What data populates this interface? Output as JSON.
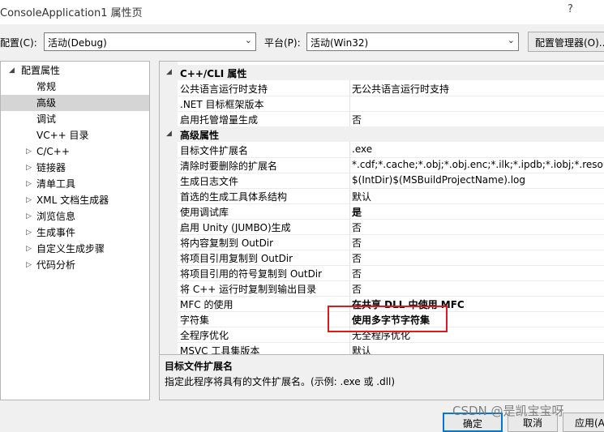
{
  "window": {
    "title": "ConsoleApplication1 属性页",
    "help": "?"
  },
  "toolbar": {
    "config_label": "配置(C):",
    "config_value": "活动(Debug)",
    "platform_label": "平台(P):",
    "platform_value": "活动(Win32)",
    "config_manager": "配置管理器(O)..."
  },
  "tree": {
    "root": "配置属性",
    "items": [
      "常规",
      "高级",
      "调试",
      "VC++ 目录",
      "C/C++",
      "链接器",
      "清单工具",
      "XML 文档生成器",
      "浏览信息",
      "生成事件",
      "自定义生成步骤",
      "代码分析"
    ],
    "selected": "高级"
  },
  "grid": {
    "cat1": "C++/CLI 属性",
    "rows1": [
      {
        "name": "公共语言运行时支持",
        "value": "无公共语言运行时支持"
      },
      {
        "name": ".NET 目标框架版本",
        "value": ""
      },
      {
        "name": "启用托管增量生成",
        "value": "否"
      }
    ],
    "cat2": "高级属性",
    "rows2": [
      {
        "name": "目标文件扩展名",
        "value": ".exe"
      },
      {
        "name": "清除时要删除的扩展名",
        "value": "*.cdf;*.cache;*.obj;*.obj.enc;*.ilk;*.ipdb;*.iobj;*.resources"
      },
      {
        "name": "生成日志文件",
        "value": "$(IntDir)$(MSBuildProjectName).log"
      },
      {
        "name": "首选的生成工具体系结构",
        "value": "默认"
      },
      {
        "name": "使用调试库",
        "value": "是"
      },
      {
        "name": "启用 Unity (JUMBO)生成",
        "value": "否"
      },
      {
        "name": "将内容复制到 OutDir",
        "value": "否"
      },
      {
        "name": "将项目引用复制到 OutDir",
        "value": "否"
      },
      {
        "name": "将项目引用的符号复制到 OutDir",
        "value": "否"
      },
      {
        "name": "将 C++ 运行时复制到输出目录",
        "value": "否"
      },
      {
        "name": "MFC 的使用",
        "value": "在共享 DLL 中使用 MFC"
      },
      {
        "name": "字符集",
        "value": "使用多字节字符集"
      },
      {
        "name": "全程序优化",
        "value": "无全程序优化"
      },
      {
        "name": "MSVC 工具集版本",
        "value": "默认"
      }
    ]
  },
  "description": {
    "title": "目标文件扩展名",
    "text": "指定此程序将具有的文件扩展名。(示例: .exe 或 .dll)"
  },
  "buttons": {
    "ok": "确定",
    "cancel": "取消",
    "apply": "应用(A"
  },
  "watermark": "CSDN @是凯宝宝呀",
  "colors": {
    "highlight_box": "#e0191c",
    "selected_bg": "#d5d5d5"
  }
}
